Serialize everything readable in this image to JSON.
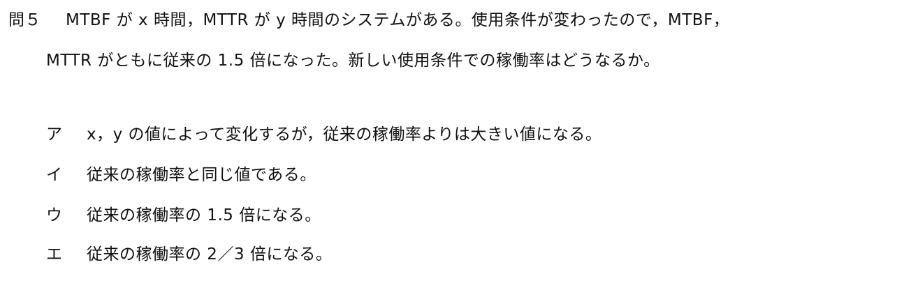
{
  "question": {
    "number": "問５",
    "line1": "MTBF が x 時間，MTTR が y 時間のシステムがある。使用条件が変わったので，MTBF，",
    "line2": "MTTR がともに従来の 1.5 倍になった。新しい使用条件での稼働率はどうなるか。"
  },
  "choices": [
    {
      "label": "ア",
      "text": "x，y の値によって変化するが，従来の稼働率よりは大きい値になる。"
    },
    {
      "label": "イ",
      "text": "従来の稼働率と同じ値である。"
    },
    {
      "label": "ウ",
      "text": "従来の稼働率の 1.5 倍になる。"
    },
    {
      "label": "エ",
      "text": "従来の稼働率の 2／3 倍になる。"
    }
  ]
}
